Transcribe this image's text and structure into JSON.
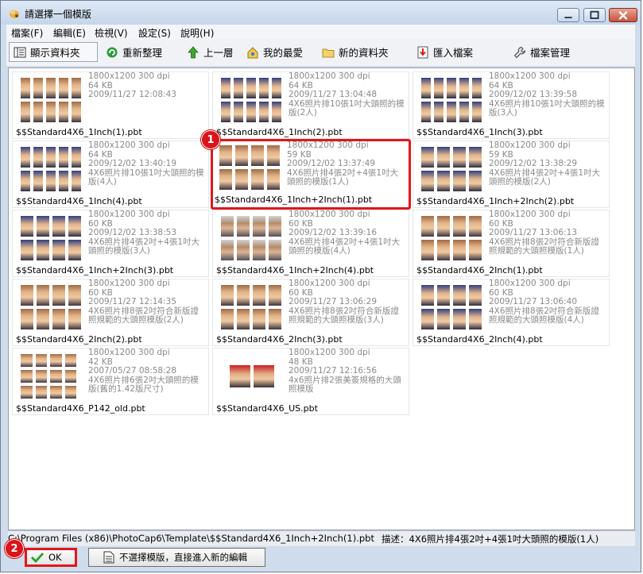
{
  "window": {
    "title": "請選擇一個模版"
  },
  "menu": [
    "檔案(F)",
    "編輯(E)",
    "檢視(V)",
    "設定(S)",
    "說明(H)"
  ],
  "toolbar": {
    "show_folder": "顯示資料夾",
    "rearrange": "重新整理",
    "up_level": "上一層",
    "favorites": "我的最愛",
    "new_folder": "新的資料夾",
    "import_file": "匯入檔案",
    "file_manager": "檔案管理"
  },
  "tiles": [
    {
      "res": "1800x1200 300 dpi",
      "size": "64 KB",
      "date": "2009/11/27 12:08:43",
      "desc": "",
      "name": "$$Standard4X6_1Inch(1).pbt"
    },
    {
      "res": "1800x1200 300 dpi",
      "size": "64 KB",
      "date": "2009/11/27 13:04:48",
      "desc": "4X6照片排10張1吋大頭照的模版(2人)",
      "name": "$$Standard4X6_1Inch(2).pbt"
    },
    {
      "res": "1800x1200 300 dpi",
      "size": "64 KB",
      "date": "2009/12/02 13:39:58",
      "desc": "4X6照片排10張1吋大頭照的模版(3人)",
      "name": "$$Standard4X6_1Inch(3).pbt"
    },
    {
      "res": "1800x1200 300 dpi",
      "size": "64 KB",
      "date": "2009/12/02 13:40:19",
      "desc": "4X6照片排10張1吋大頭照的模版(4人)",
      "name": "$$Standard4X6_1Inch(4).pbt"
    },
    {
      "res": "1800x1200 300 dpi",
      "size": "59 KB",
      "date": "2009/12/02 13:37:49",
      "desc": "4X6照片排4張2吋+4張1吋大頭照的模版(1人)",
      "name": "$$Standard4X6_1Inch+2Inch(1).pbt"
    },
    {
      "res": "1800x1200 300 dpi",
      "size": "59 KB",
      "date": "2009/12/02 13:38:29",
      "desc": "4X6照片排4張2吋+4張1吋大頭照的模版(2人)",
      "name": "$$Standard4X6_1Inch+2Inch(2).pbt"
    },
    {
      "res": "1800x1200 300 dpi",
      "size": "60 KB",
      "date": "2009/12/02 13:38:53",
      "desc": "4X6照片排4張2吋+4張1吋大頭照的模版(3人)",
      "name": "$$Standard4X6_1Inch+2Inch(3).pbt"
    },
    {
      "res": "1800x1200 300 dpi",
      "size": "60 KB",
      "date": "2009/12/02 13:39:16",
      "desc": "4X6照片排4張2吋+4張1吋大頭照的模版(4人)",
      "name": "$$Standard4X6_1Inch+2Inch(4).pbt"
    },
    {
      "res": "1800x1200 300 dpi",
      "size": "60 KB",
      "date": "2009/11/27 13:06:13",
      "desc": "4X6照片排8張2吋符合新版證照規範的大頭照模版(1人)",
      "name": "$$Standard4X6_2Inch(1).pbt"
    },
    {
      "res": "1800x1200 300 dpi",
      "size": "60 KB",
      "date": "2009/11/27 12:14:35",
      "desc": "4X6照片排8張2吋符合新版證照規範的大頭照模版(2人)",
      "name": "$$Standard4X6_2Inch(2).pbt"
    },
    {
      "res": "1800x1200 300 dpi",
      "size": "60 KB",
      "date": "2009/11/27 13:06:29",
      "desc": "4X6照片排8張2吋符合新版證照規範的大頭照模版(3人)",
      "name": "$$Standard4X6_2Inch(3).pbt"
    },
    {
      "res": "1800x1200 300 dpi",
      "size": "60 KB",
      "date": "2009/11/27 13:06:40",
      "desc": "4X6照片排8張2吋符合新版證照規範的大頭照模版(4人)",
      "name": "$$Standard4X6_2Inch(4).pbt"
    },
    {
      "res": "1800x1200 300 dpi",
      "size": "42 KB",
      "date": "2007/05/27 08:58:28",
      "desc": "4X6照片排6張2吋大頭照的模版(舊的1.42版尺寸)",
      "name": "$$Standard4X6_P142_old.pbt"
    },
    {
      "res": "1800x1200 300 dpi",
      "size": "48 KB",
      "date": "2009/11/27 12:16:56",
      "desc": "4x6照片排2張美簽規格的大頭照模版",
      "name": "$$Standard4X6_US.pbt"
    }
  ],
  "status": {
    "path": "C:\\Program Files (x86)\\PhotoCap6\\Template\\$$Standard4X6_1Inch+2Inch(1).pbt",
    "desc": "描述：4X6照片排4張2吋+4張1吋大頭照的模版(1人)"
  },
  "buttons": {
    "ok": "OK",
    "no_template": "不選擇模版，直接進入新的編輯"
  },
  "markers": [
    "1",
    "2"
  ]
}
